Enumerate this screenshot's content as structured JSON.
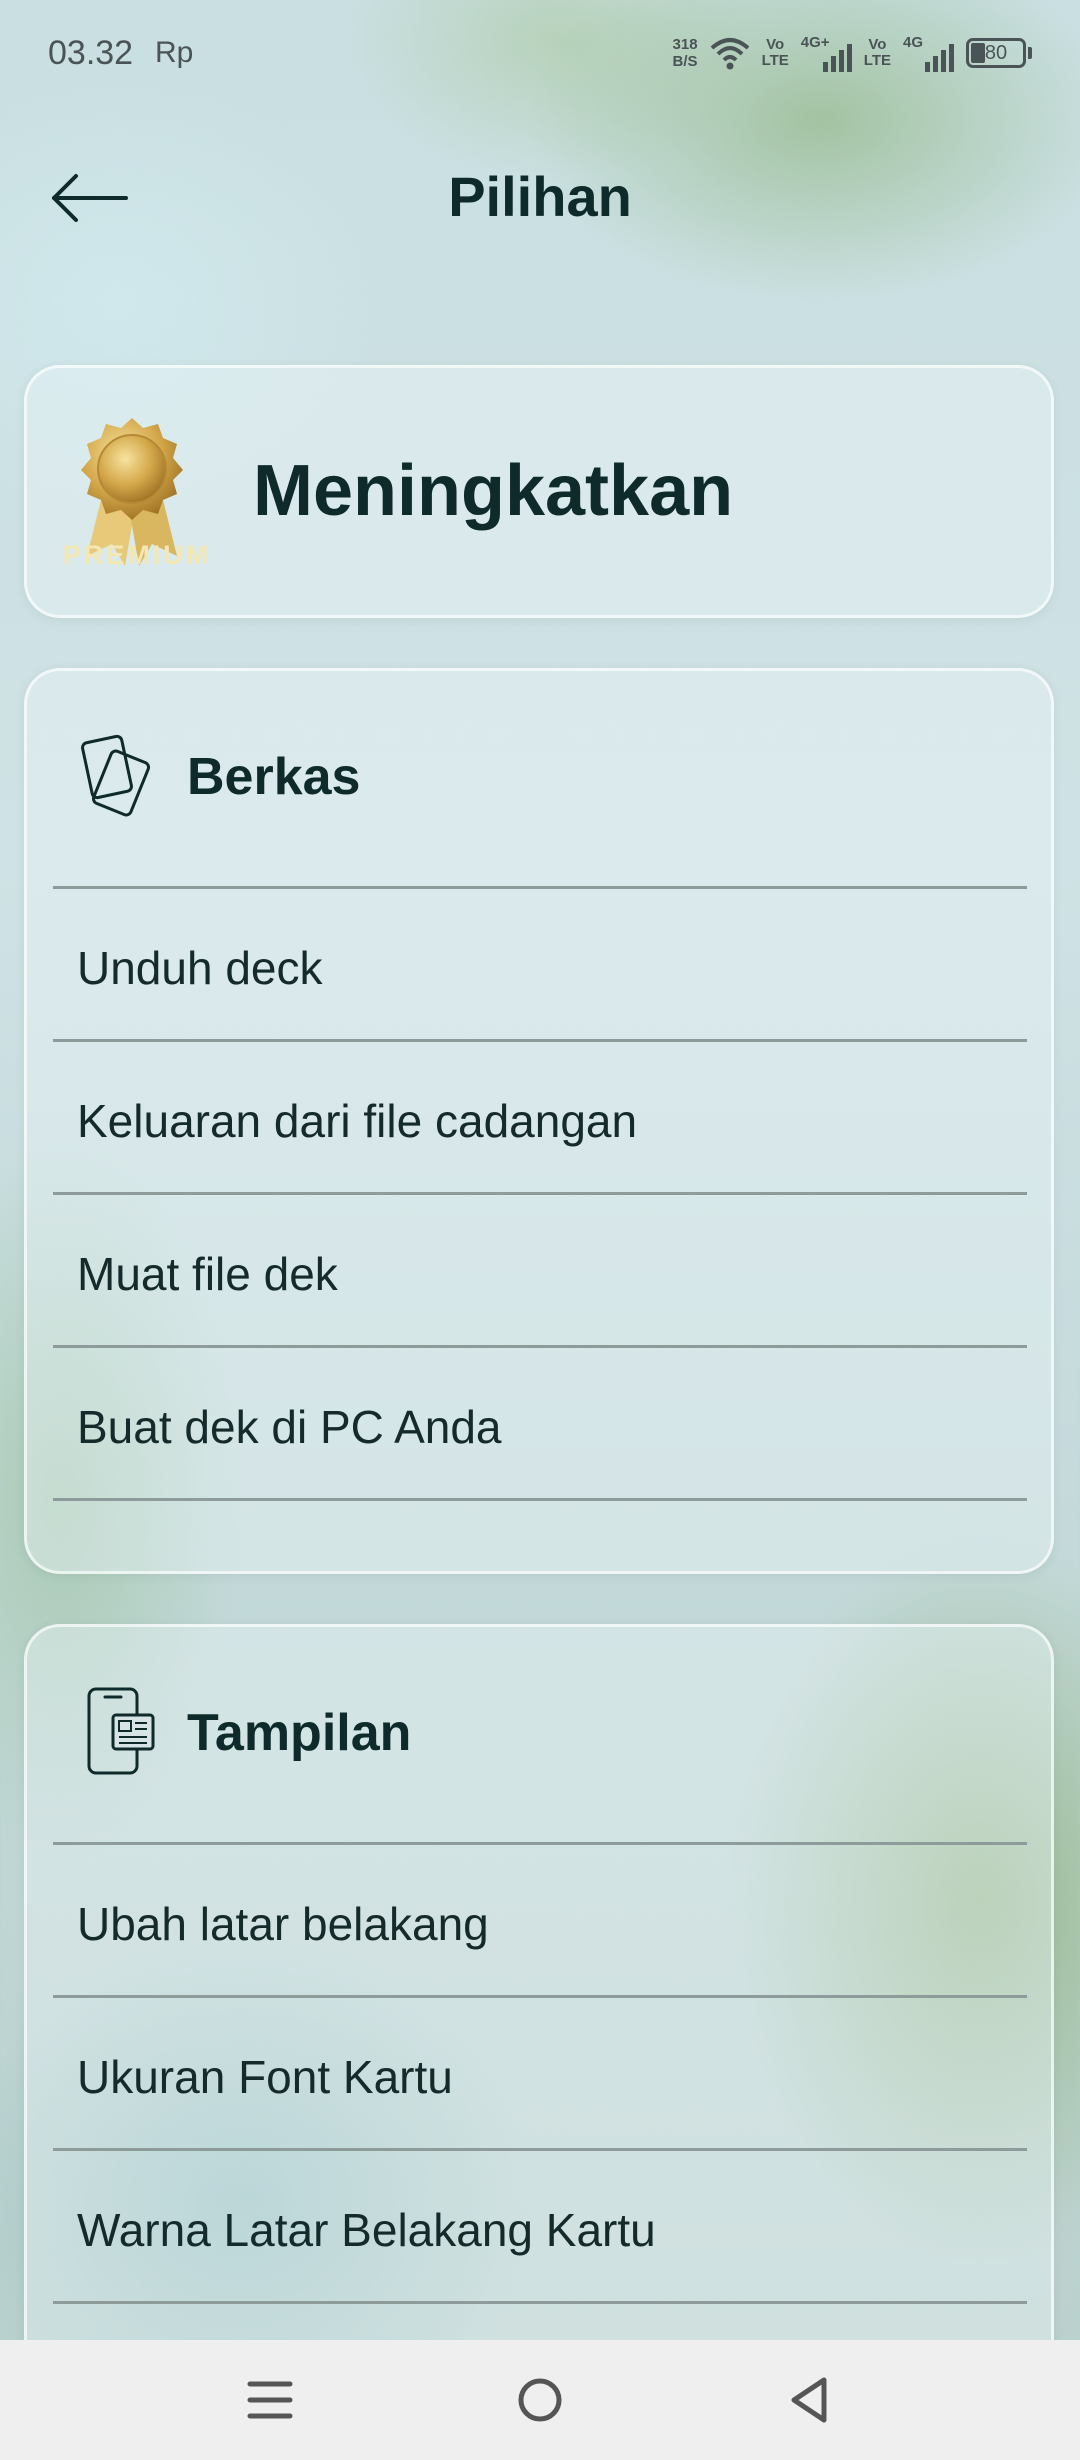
{
  "status_bar": {
    "time": "03.32",
    "carrier_icon_text": "Rp",
    "net_speed_value": "318",
    "net_speed_unit": "B/S",
    "volte_1_top": "Vo",
    "volte_1_bottom": "LTE",
    "sim1_network": "4G+",
    "volte_2_top": "Vo",
    "volte_2_bottom": "LTE",
    "sim2_network": "4G",
    "battery_level": "80",
    "icons": [
      "wifi-icon",
      "signal-icon",
      "battery-icon"
    ]
  },
  "header": {
    "title": "Pilihan",
    "back_icon": "arrow-left-icon"
  },
  "premium": {
    "badge_text": "PREMIUM",
    "title": "Meningkatkan",
    "badge_icon": "gold-medal-icon"
  },
  "sections": [
    {
      "title": "Berkas",
      "icon": "cards-icon",
      "items": [
        "Unduh deck",
        "Keluaran dari file cadangan",
        "Muat file dek",
        "Buat dek di PC Anda"
      ]
    },
    {
      "title": "Tampilan",
      "icon": "phone-display-icon",
      "items": [
        "Ubah latar belakang",
        "Ukuran Font Kartu",
        "Warna Latar Belakang Kartu"
      ]
    }
  ],
  "nav_bar": {
    "icons": [
      "menu-icon",
      "home-icon",
      "back-icon"
    ]
  },
  "colors": {
    "text_dark": "#0f2a2a",
    "divider": "#8d9b9b",
    "gold": "#d4a84a",
    "nav_bg": "#efefef"
  }
}
